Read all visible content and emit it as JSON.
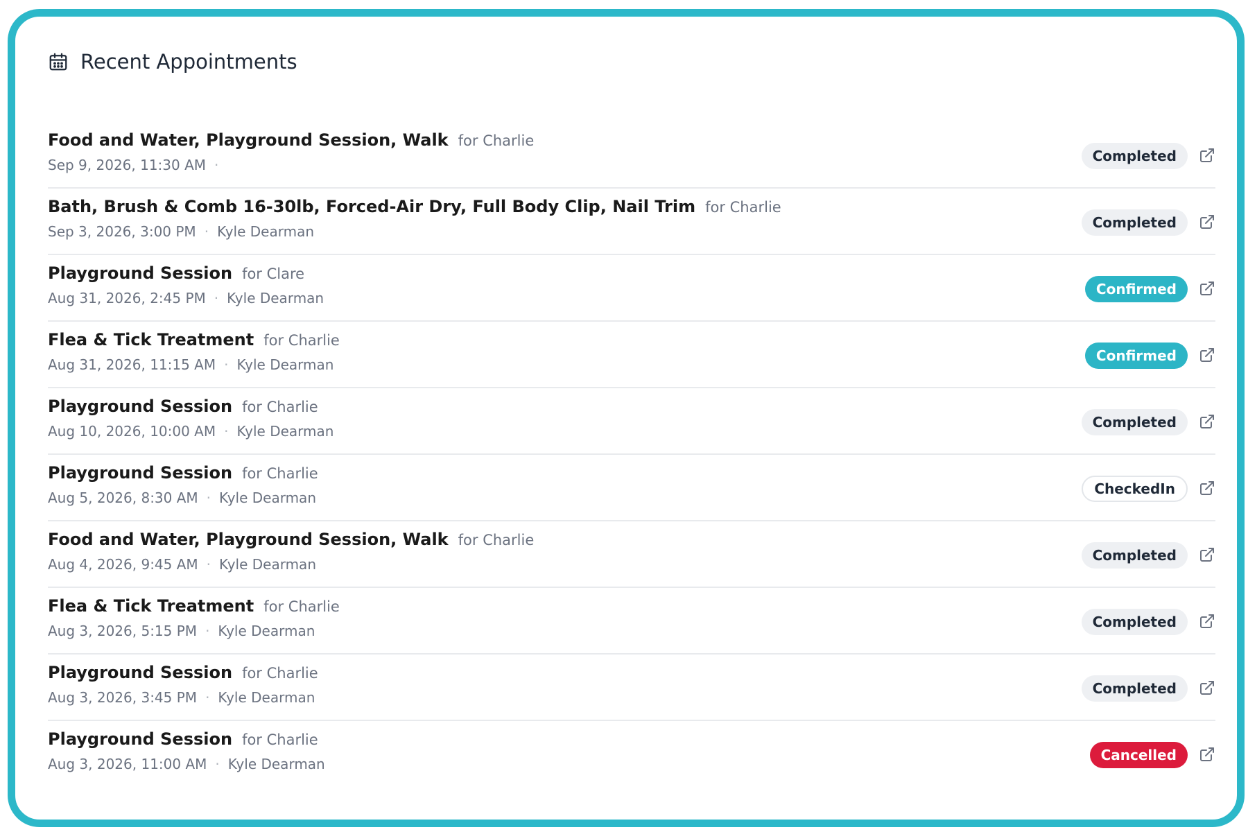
{
  "header": {
    "title": "Recent Appointments",
    "icon": "calendar-icon"
  },
  "colors": {
    "frame": "#2cb8c9",
    "confirmed": "#2cb5c6",
    "cancelled": "#dc1b3c",
    "completed_bg": "#eef0f3"
  },
  "appointments": [
    {
      "service": "Food and Water, Playground Session, Walk",
      "pet": "for Charlie",
      "datetime": "Sep 9, 2026, 11:30 AM",
      "separator": "·",
      "staff": "",
      "status": "Completed",
      "status_type": "completed",
      "action_icon": "external-link-icon"
    },
    {
      "service": "Bath, Brush & Comb 16-30lb, Forced-Air Dry, Full Body Clip, Nail Trim",
      "pet": "for Charlie",
      "datetime": "Sep 3, 2026, 3:00 PM",
      "separator": "·",
      "staff": "Kyle Dearman",
      "status": "Completed",
      "status_type": "completed",
      "action_icon": "external-link-icon"
    },
    {
      "service": "Playground Session",
      "pet": "for Clare",
      "datetime": "Aug 31, 2026, 2:45 PM",
      "separator": "·",
      "staff": "Kyle Dearman",
      "status": "Confirmed",
      "status_type": "confirmed",
      "action_icon": "external-link-icon"
    },
    {
      "service": "Flea & Tick Treatment",
      "pet": "for Charlie",
      "datetime": "Aug 31, 2026, 11:15 AM",
      "separator": "·",
      "staff": "Kyle Dearman",
      "status": "Confirmed",
      "status_type": "confirmed",
      "action_icon": "external-link-icon"
    },
    {
      "service": "Playground Session",
      "pet": "for Charlie",
      "datetime": "Aug 10, 2026, 10:00 AM",
      "separator": "·",
      "staff": "Kyle Dearman",
      "status": "Completed",
      "status_type": "completed",
      "action_icon": "external-link-icon"
    },
    {
      "service": "Playground Session",
      "pet": "for Charlie",
      "datetime": "Aug 5, 2026, 8:30 AM",
      "separator": "·",
      "staff": "Kyle Dearman",
      "status": "CheckedIn",
      "status_type": "checkedin",
      "action_icon": "external-link-icon"
    },
    {
      "service": "Food and Water, Playground Session, Walk",
      "pet": "for Charlie",
      "datetime": "Aug 4, 2026, 9:45 AM",
      "separator": "·",
      "staff": "Kyle Dearman",
      "status": "Completed",
      "status_type": "completed",
      "action_icon": "external-link-icon"
    },
    {
      "service": "Flea & Tick Treatment",
      "pet": "for Charlie",
      "datetime": "Aug 3, 2026, 5:15 PM",
      "separator": "·",
      "staff": "Kyle Dearman",
      "status": "Completed",
      "status_type": "completed",
      "action_icon": "external-link-icon"
    },
    {
      "service": "Playground Session",
      "pet": "for Charlie",
      "datetime": "Aug 3, 2026, 3:45 PM",
      "separator": "·",
      "staff": "Kyle Dearman",
      "status": "Completed",
      "status_type": "completed",
      "action_icon": "external-link-icon"
    },
    {
      "service": "Playground Session",
      "pet": "for Charlie",
      "datetime": "Aug 3, 2026, 11:00 AM",
      "separator": "·",
      "staff": "Kyle Dearman",
      "status": "Cancelled",
      "status_type": "cancelled",
      "action_icon": "external-link-icon"
    }
  ]
}
